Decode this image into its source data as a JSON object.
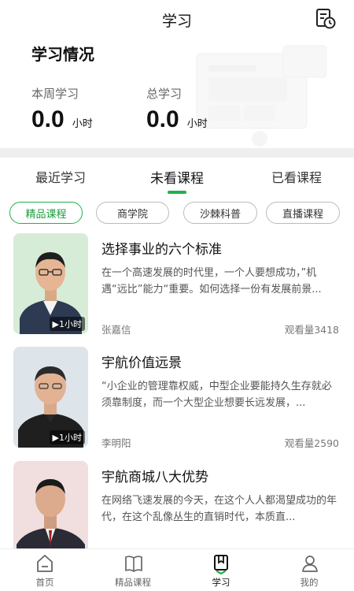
{
  "header": {
    "title": "学习"
  },
  "stats": {
    "title": "学习情况",
    "week": {
      "label": "本周学习",
      "value": "0.0",
      "unit": "小时"
    },
    "total": {
      "label": "总学习",
      "value": "0.0",
      "unit": "小时"
    }
  },
  "tabs": [
    {
      "label": "最近学习"
    },
    {
      "label": "未看课程"
    },
    {
      "label": "已看课程"
    }
  ],
  "chips": [
    {
      "label": "精品课程"
    },
    {
      "label": "商学院"
    },
    {
      "label": "沙棘科普"
    },
    {
      "label": "直播课程"
    }
  ],
  "courses": [
    {
      "title": "选择事业的六个标准",
      "desc": "在一个高速发展的时代里，一个人要想成功，”机遇“远比”能力“重要。如何选择一份有发展前景...",
      "author": "张嘉信",
      "views": "观看量3418",
      "duration": "▶1小时",
      "bg": "#d6ecd6"
    },
    {
      "title": "宇航价值远景",
      "desc": "“小企业的管理靠权威，中型企业要能持久生存就必须靠制度，而一个大型企业想要长远发展，...",
      "author": "李明阳",
      "views": "观看量2590",
      "duration": "▶1小时",
      "bg": "#dde4ea"
    },
    {
      "title": "宇航商城八大优势",
      "desc": "在网络飞速发展的今天，在这个人人都渴望成功的年代，在这个乱像丛生的直销时代，本质直...",
      "author": "",
      "views": "",
      "duration": "",
      "bg": "#f1dede"
    }
  ],
  "nav": [
    {
      "label": "首页"
    },
    {
      "label": "精品课程"
    },
    {
      "label": "学习"
    },
    {
      "label": "我的"
    }
  ],
  "colors": {
    "accent": "#20b24a"
  }
}
